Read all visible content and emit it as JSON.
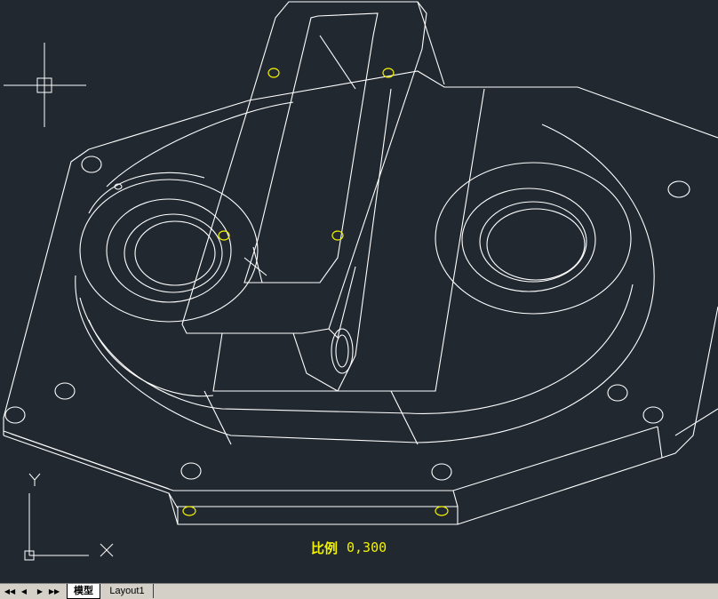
{
  "viewport": {
    "background": "#212830",
    "line_color": "#ffffff",
    "hole_marker_color": "#f2f200",
    "crosshair_icon": "crosshair-cursor-icon",
    "ucs_icon": "ucs-axis-icon",
    "ucs_y_label": "Y",
    "ucs_x_label": "X"
  },
  "scale": {
    "label": "比例",
    "value": "0,300"
  },
  "tabbar": {
    "nav_first_icon": "first-tab-icon",
    "nav_prev_icon": "prev-tab-icon",
    "nav_next_icon": "next-tab-icon",
    "nav_last_icon": "last-tab-icon",
    "tabs": [
      {
        "label": "模型",
        "active": true
      },
      {
        "label": "Layout1",
        "active": false
      }
    ]
  }
}
